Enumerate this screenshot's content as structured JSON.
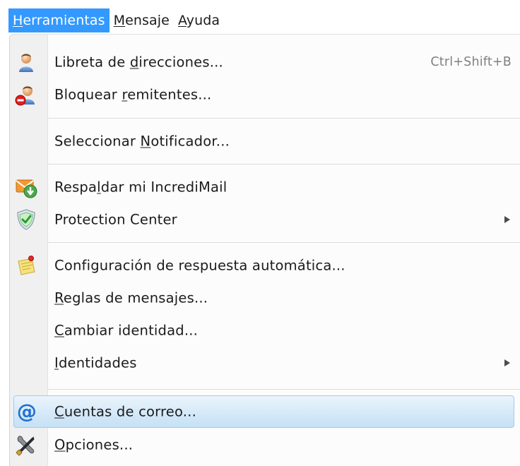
{
  "menubar": {
    "items": [
      {
        "label": "Herramientas",
        "active": true
      },
      {
        "label": "Mensaje",
        "active": false
      },
      {
        "label": "Ayuda",
        "active": false
      }
    ]
  },
  "menu": {
    "items": [
      {
        "label": "Libreta de direcciones...",
        "shortcut": "Ctrl+Shift+B",
        "icon": "address-book-icon"
      },
      {
        "label": "Bloquear remitentes...",
        "icon": "block-sender-icon"
      },
      {
        "label": "Seleccionar Notificador..."
      },
      {
        "label": "Respaldar mi IncrediMail",
        "icon": "backup-icon"
      },
      {
        "label": "Protection Center",
        "icon": "shield-icon",
        "submenu": true
      },
      {
        "label": "Configuración de respuesta automática...",
        "icon": "auto-reply-note-icon"
      },
      {
        "label": "Reglas de mensajes..."
      },
      {
        "label": "Cambiar identidad..."
      },
      {
        "label": "Identidades",
        "submenu": true
      },
      {
        "label": "Cuentas de correo...",
        "icon": "at-sign-icon",
        "highlighted": true
      },
      {
        "label": "Opciones...",
        "icon": "tools-icon"
      }
    ]
  },
  "colors": {
    "menubar_active_bg": "#3399ff",
    "highlight_border": "#a4cbea",
    "shortcut_text": "#808080"
  }
}
